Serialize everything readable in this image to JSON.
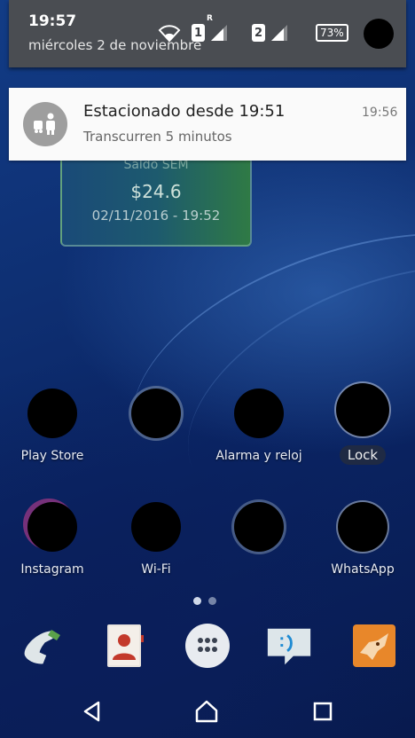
{
  "status_bar": {
    "time": "19:57",
    "date": "miércoles 2 de noviembre",
    "sim1": "1",
    "sim1_tag": "R",
    "sim2": "2",
    "battery": "73%"
  },
  "notification": {
    "title": "Estacionado desde 19:51",
    "text": "Transcurren 5 minutos",
    "time": "19:56",
    "icon": "parking-attendant-icon"
  },
  "widget": {
    "label": "Saldo SEM",
    "amount": "$24.6",
    "date": "02/11/2016 - 19:52"
  },
  "home_apps": [
    {
      "label": "Play Store"
    },
    {
      "label": ""
    },
    {
      "label": "Alarma y reloj"
    },
    {
      "label": "Lock"
    },
    {
      "label": "Instagram"
    },
    {
      "label": "Wi-Fi"
    },
    {
      "label": ""
    },
    {
      "label": "WhatsApp"
    }
  ],
  "dock": [
    "phone-icon",
    "contacts-icon",
    "app-drawer-icon",
    "messaging-icon",
    "browser-icon"
  ],
  "nav": [
    "back-icon",
    "home-icon",
    "recents-icon"
  ],
  "colors": {
    "notification_bg": "#fafafa",
    "shade_bg": "#4a4d52",
    "accent": "#0e2f72"
  }
}
